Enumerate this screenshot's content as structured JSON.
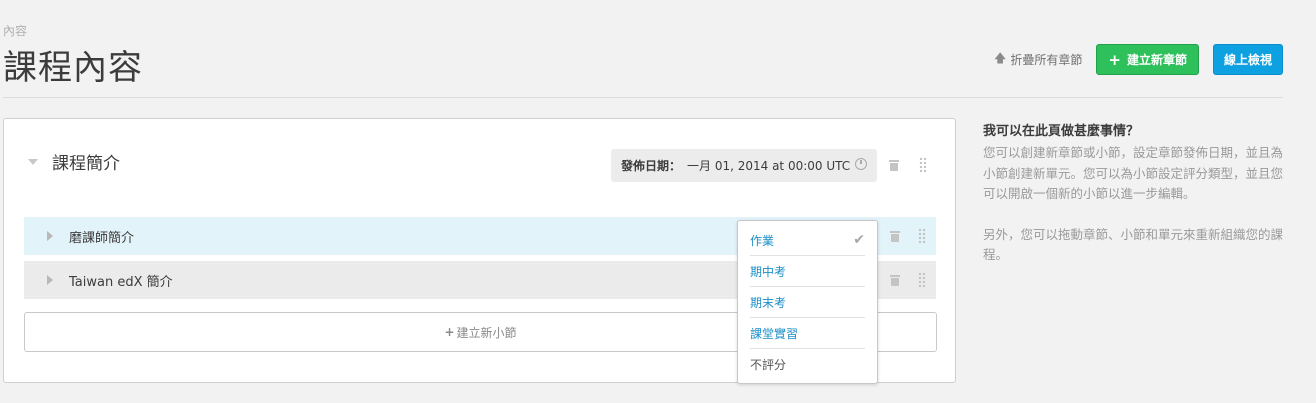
{
  "header": {
    "breadcrumb": "內容",
    "title": "課程內容",
    "collapse_all": "折疊所有章節",
    "new_section_button": "建立新章節",
    "view_live_button": "線上檢視"
  },
  "section": {
    "title": "課程簡介",
    "release_label": "發佈日期：",
    "release_value": "一月 01, 2014 at 00:00 UTC"
  },
  "subsections": [
    {
      "label": "磨課師簡介"
    },
    {
      "label": "Taiwan edX 簡介"
    }
  ],
  "new_subsection_button": "建立新小節",
  "grading_dropdown": {
    "options": [
      "作業",
      "期中考",
      "期末考",
      "課堂實習",
      "不評分"
    ],
    "selected": "作業"
  },
  "help": {
    "title": "我可以在此頁做甚麼事情？",
    "paragraph1": "您可以創建新章節或小節，設定章節發佈日期，並且為小節創建新單元。您可以為小節設定評分類型，並且您可以開啟一個新的小節以進一步編輯。",
    "paragraph2": "另外，您可以拖動章節、小節和單元來重新組織您的課程。"
  },
  "colors": {
    "green_button": "#2ec05b",
    "blue_button": "#0ea1e2",
    "link_blue": "#1b8fc7",
    "row_highlight": "#e3f3fa"
  }
}
